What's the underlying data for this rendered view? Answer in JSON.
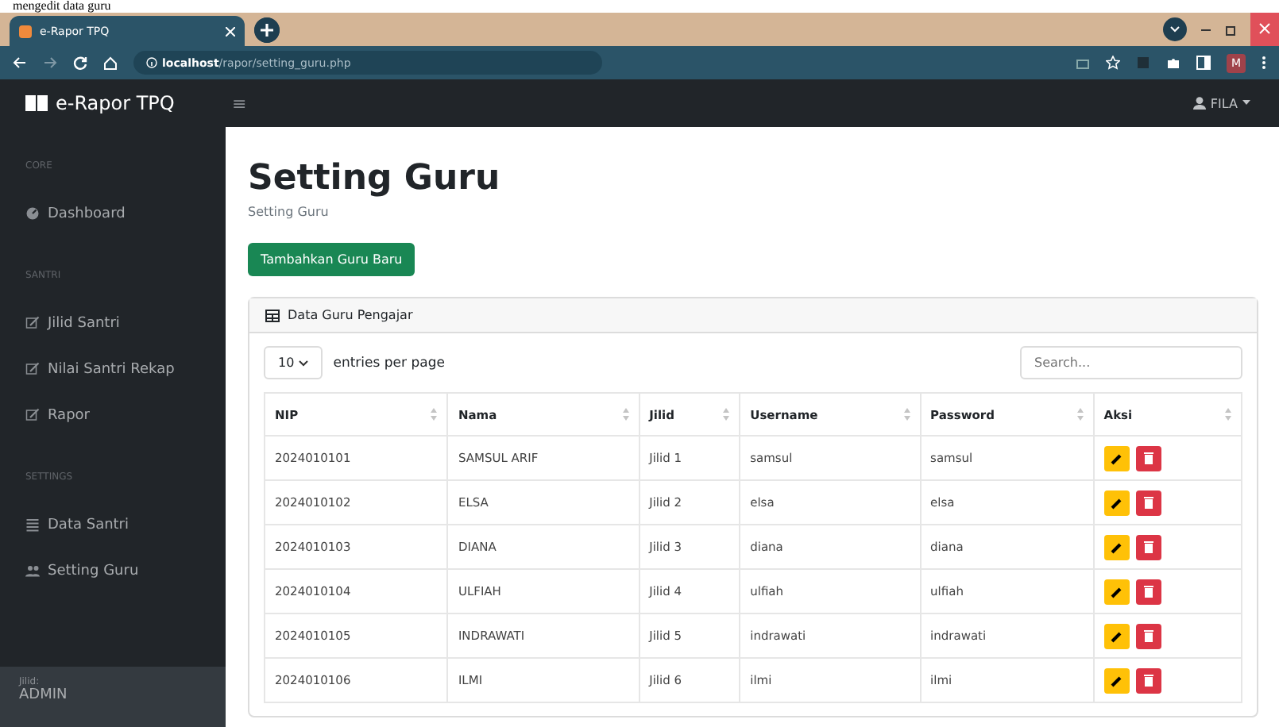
{
  "caption": "mengedit data guru",
  "browser": {
    "tab_title": "e-Rapor TPQ",
    "url_host": "localhost",
    "url_path": "/rapor/setting_guru.php",
    "profile": "M"
  },
  "navbar": {
    "brand": "e-Rapor TPQ",
    "menu": "≡",
    "user": "FILA"
  },
  "sidebar": {
    "sections": [
      {
        "heading": "CORE",
        "items": [
          {
            "label": "Dashboard"
          }
        ]
      },
      {
        "heading": "SANTRI",
        "items": [
          {
            "label": "Jilid Santri"
          },
          {
            "label": "Nilai Santri Rekap"
          },
          {
            "label": "Rapor"
          }
        ]
      },
      {
        "heading": "SETTINGS",
        "items": [
          {
            "label": "Data Santri"
          },
          {
            "label": "Setting Guru"
          }
        ]
      }
    ],
    "footer_label": "Jilid:",
    "footer_value": "ADMIN"
  },
  "page": {
    "title": "Setting Guru",
    "breadcrumb": "Setting Guru",
    "add_button": "Tambahkan Guru Baru"
  },
  "card": {
    "title": "Data Guru Pengajar",
    "per_page": "10",
    "per_page_label": "entries per page",
    "search_placeholder": "Search...",
    "columns": [
      "NIP",
      "Nama",
      "Jilid",
      "Username",
      "Password",
      "Aksi"
    ],
    "rows": [
      [
        "2024010101",
        "SAMSUL ARIF",
        "Jilid 1",
        "samsul",
        "samsul"
      ],
      [
        "2024010102",
        "ELSA",
        "Jilid 2",
        "elsa",
        "elsa"
      ],
      [
        "2024010103",
        "DIANA",
        "Jilid 3",
        "diana",
        "diana"
      ],
      [
        "2024010104",
        "ULFIAH",
        "Jilid 4",
        "ulfiah",
        "ulfiah"
      ],
      [
        "2024010105",
        "INDRAWATI",
        "Jilid 5",
        "indrawati",
        "indrawati"
      ],
      [
        "2024010106",
        "ILMI",
        "Jilid 6",
        "ilmi",
        "ilmi"
      ]
    ]
  }
}
